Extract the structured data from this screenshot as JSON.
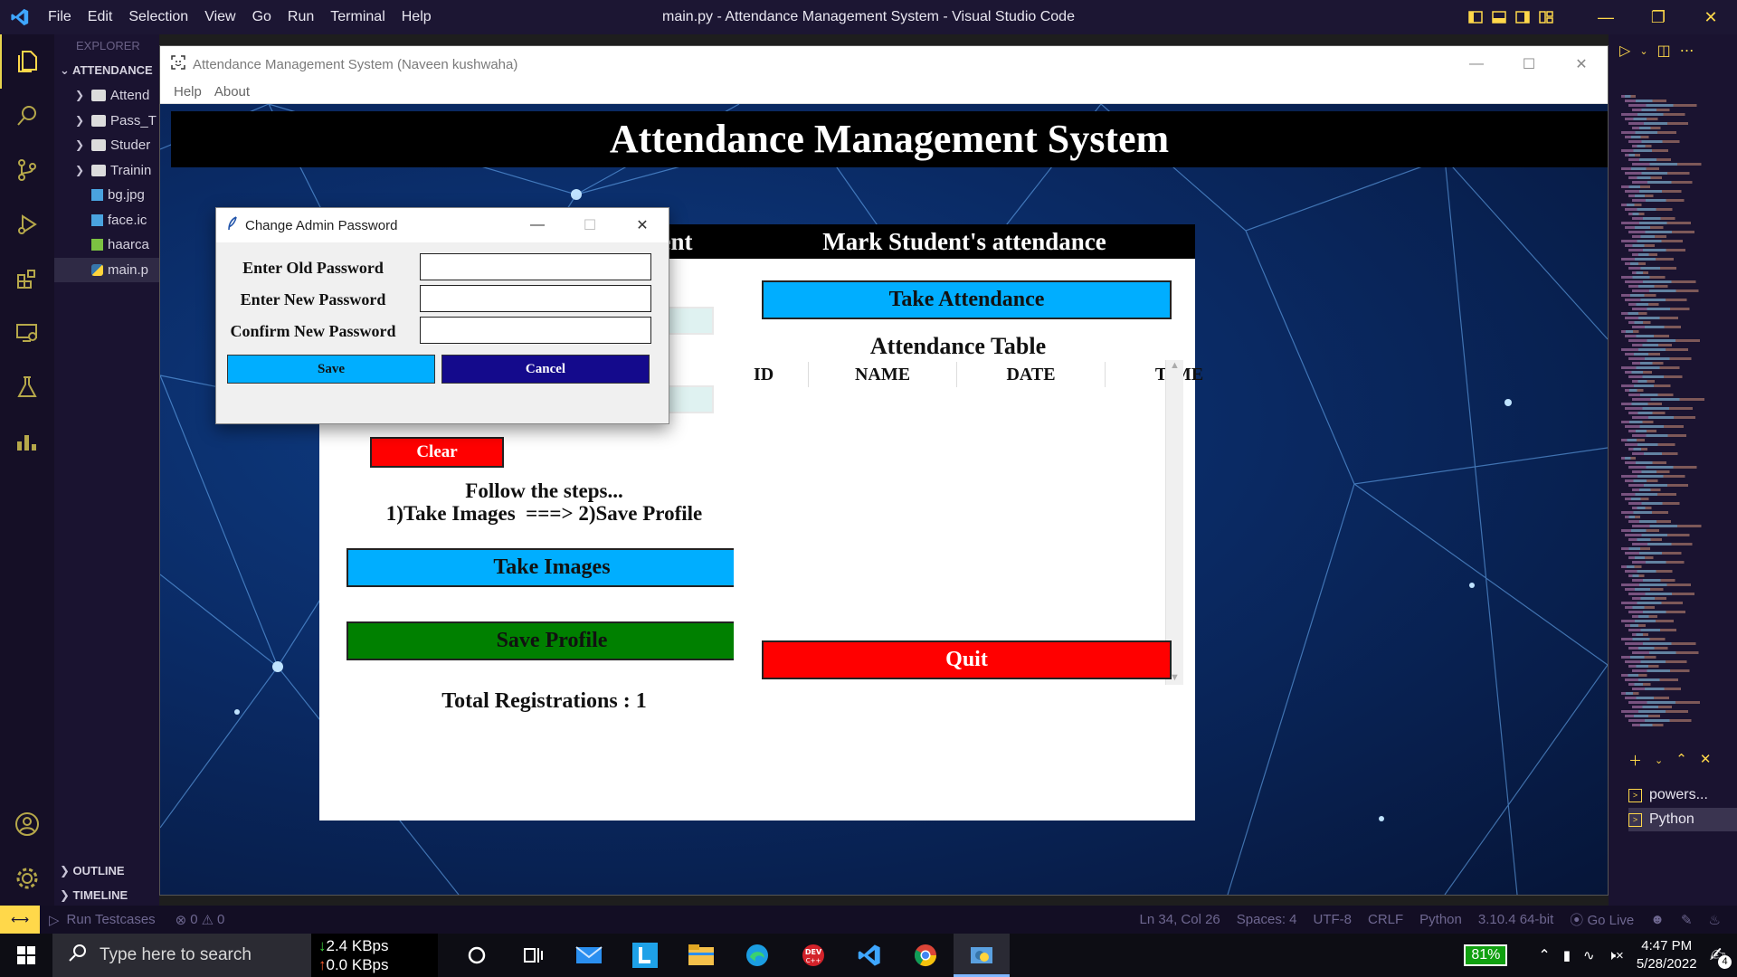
{
  "vscode": {
    "menu": [
      "File",
      "Edit",
      "Selection",
      "View",
      "Go",
      "Run",
      "Terminal",
      "Help"
    ],
    "window_title": "main.py - Attendance Management System - Visual Studio Code",
    "explorer": {
      "header": "EXPLORER",
      "root": "ATTENDANCE",
      "items": [
        {
          "label": "Attend",
          "type": "folder"
        },
        {
          "label": "Pass_T",
          "type": "folder"
        },
        {
          "label": "Studer",
          "type": "folder"
        },
        {
          "label": "Trainin",
          "type": "folder"
        },
        {
          "label": "bg.jpg",
          "type": "image"
        },
        {
          "label": "face.ic",
          "type": "image"
        },
        {
          "label": "haarca",
          "type": "xml"
        },
        {
          "label": "main.p",
          "type": "python"
        }
      ],
      "outline": "OUTLINE",
      "timeline": "TIMELINE"
    },
    "terminals": [
      "powers...",
      "Python"
    ],
    "status": {
      "run_testcases": "Run Testcases",
      "problems": "0",
      "warnings": "0",
      "position": "Ln 34, Col 26",
      "spaces": "Spaces: 4",
      "encoding": "UTF-8",
      "eol": "CRLF",
      "language": "Python",
      "interpreter": "3.10.4 64-bit",
      "golive": "Go Live"
    }
  },
  "app": {
    "window_title": "Attendance Management System (Naveen kushwaha)",
    "menu": [
      "Help",
      "About"
    ],
    "heading": "Attendance Management System",
    "left_frame": {
      "title_fragment": "ident",
      "clear_label": "Clear",
      "steps_title": "Follow the steps...",
      "steps_text": "1)Take Images  ===> 2)Save Profile",
      "take_images_label": "Take Images",
      "save_profile_label": "Save Profile",
      "total_registrations": "Total Registrations : 1"
    },
    "right_frame": {
      "title": "Mark Student's attendance",
      "take_attendance_label": "Take Attendance",
      "table_title": "Attendance Table",
      "columns": [
        "ID",
        "NAME",
        "DATE",
        "TIME"
      ],
      "quit_label": "Quit"
    },
    "colors": {
      "sky_blue": "#00aeff",
      "green": "#008000",
      "red": "#ff0000",
      "navy": "#140a8c"
    }
  },
  "dialog": {
    "title": "Change Admin Password",
    "labels": [
      "Enter Old Password",
      "Enter New Password",
      "Confirm New Password"
    ],
    "save_label": "Save",
    "cancel_label": "Cancel"
  },
  "taskbar": {
    "search_placeholder": "Type here to search",
    "net_down": "2.4 KBps",
    "net_up": "0.0 KBps",
    "battery": "81%",
    "time": "4:47 PM",
    "date": "5/28/2022",
    "notifications": "4"
  }
}
